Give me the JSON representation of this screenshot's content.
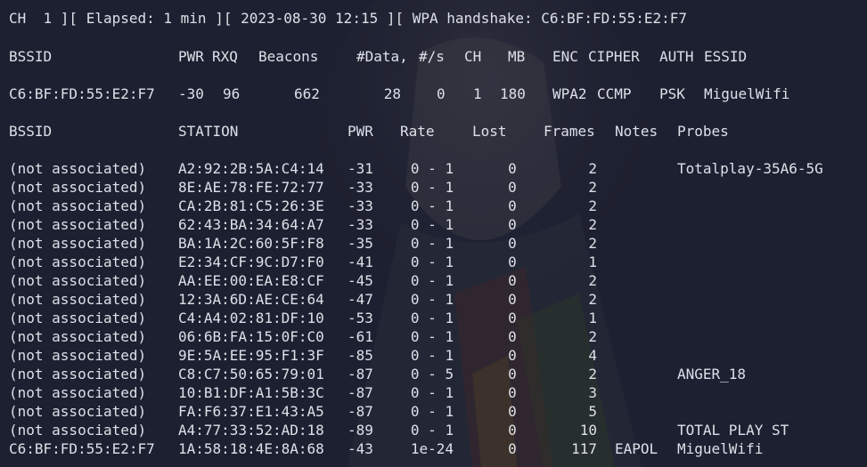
{
  "status_line": "CH  1 ][ Elapsed: 1 min ][ 2023-08-30 12:15 ][ WPA handshake: C6:BF:FD:55:E2:F7",
  "ap_headers": {
    "bssid": "BSSID",
    "pwr": "PWR",
    "rxq": "RXQ",
    "beacons": "Beacons",
    "data": "#Data,",
    "per_sec": "#/s",
    "ch": "CH",
    "mb": "MB",
    "enc": "ENC",
    "cipher": "CIPHER",
    "auth": "AUTH",
    "essid": "ESSID"
  },
  "access_points": [
    {
      "bssid": "C6:BF:FD:55:E2:F7",
      "pwr": "-30",
      "rxq": "96",
      "beacons": "662",
      "data": "28",
      "per_sec": "0",
      "ch": "1",
      "mb": "180",
      "enc": "WPA2",
      "cipher": "CCMP",
      "auth": "PSK",
      "essid": "MiguelWifi"
    }
  ],
  "station_headers": {
    "bssid": "BSSID",
    "station": "STATION",
    "pwr": "PWR",
    "rate": "Rate",
    "lost": "Lost",
    "frames": "Frames",
    "notes": "Notes",
    "probes": "Probes"
  },
  "stations": [
    {
      "bssid": "(not associated)",
      "station": "A2:92:2B:5A:C4:14",
      "pwr": "-31",
      "rate": "0 - 1",
      "lost": "0",
      "frames": "2",
      "notes": "",
      "probes": "Totalplay-35A6-5G"
    },
    {
      "bssid": "(not associated)",
      "station": "8E:AE:78:FE:72:77",
      "pwr": "-33",
      "rate": "0 - 1",
      "lost": "0",
      "frames": "2",
      "notes": "",
      "probes": ""
    },
    {
      "bssid": "(not associated)",
      "station": "CA:2B:81:C5:26:3E",
      "pwr": "-33",
      "rate": "0 - 1",
      "lost": "0",
      "frames": "2",
      "notes": "",
      "probes": ""
    },
    {
      "bssid": "(not associated)",
      "station": "62:43:BA:34:64:A7",
      "pwr": "-33",
      "rate": "0 - 1",
      "lost": "0",
      "frames": "2",
      "notes": "",
      "probes": ""
    },
    {
      "bssid": "(not associated)",
      "station": "BA:1A:2C:60:5F:F8",
      "pwr": "-35",
      "rate": "0 - 1",
      "lost": "0",
      "frames": "2",
      "notes": "",
      "probes": ""
    },
    {
      "bssid": "(not associated)",
      "station": "E2:34:CF:9C:D7:F0",
      "pwr": "-41",
      "rate": "0 - 1",
      "lost": "0",
      "frames": "1",
      "notes": "",
      "probes": ""
    },
    {
      "bssid": "(not associated)",
      "station": "AA:EE:00:EA:E8:CF",
      "pwr": "-45",
      "rate": "0 - 1",
      "lost": "0",
      "frames": "2",
      "notes": "",
      "probes": ""
    },
    {
      "bssid": "(not associated)",
      "station": "12:3A:6D:AE:CE:64",
      "pwr": "-47",
      "rate": "0 - 1",
      "lost": "0",
      "frames": "2",
      "notes": "",
      "probes": ""
    },
    {
      "bssid": "(not associated)",
      "station": "C4:A4:02:81:DF:10",
      "pwr": "-53",
      "rate": "0 - 1",
      "lost": "0",
      "frames": "1",
      "notes": "",
      "probes": ""
    },
    {
      "bssid": "(not associated)",
      "station": "06:6B:FA:15:0F:C0",
      "pwr": "-61",
      "rate": "0 - 1",
      "lost": "0",
      "frames": "2",
      "notes": "",
      "probes": ""
    },
    {
      "bssid": "(not associated)",
      "station": "9E:5A:EE:95:F1:3F",
      "pwr": "-85",
      "rate": "0 - 1",
      "lost": "0",
      "frames": "4",
      "notes": "",
      "probes": ""
    },
    {
      "bssid": "(not associated)",
      "station": "C8:C7:50:65:79:01",
      "pwr": "-87",
      "rate": "0 - 5",
      "lost": "0",
      "frames": "2",
      "notes": "",
      "probes": "ANGER_18"
    },
    {
      "bssid": "(not associated)",
      "station": "10:B1:DF:A1:5B:3C",
      "pwr": "-87",
      "rate": "0 - 1",
      "lost": "0",
      "frames": "3",
      "notes": "",
      "probes": ""
    },
    {
      "bssid": "(not associated)",
      "station": "FA:F6:37:E1:43:A5",
      "pwr": "-87",
      "rate": "0 - 1",
      "lost": "0",
      "frames": "5",
      "notes": "",
      "probes": ""
    },
    {
      "bssid": "(not associated)",
      "station": "A4:77:33:52:AD:18",
      "pwr": "-89",
      "rate": "0 - 1",
      "lost": "0",
      "frames": "10",
      "notes": "",
      "probes": "TOTAL PLAY ST"
    },
    {
      "bssid": "C6:BF:FD:55:E2:F7",
      "station": "1A:58:18:4E:8A:68",
      "pwr": "-43",
      "rate": "1e-24",
      "lost": "0",
      "frames": "117",
      "notes": "EAPOL",
      "probes": "MiguelWifi"
    }
  ]
}
